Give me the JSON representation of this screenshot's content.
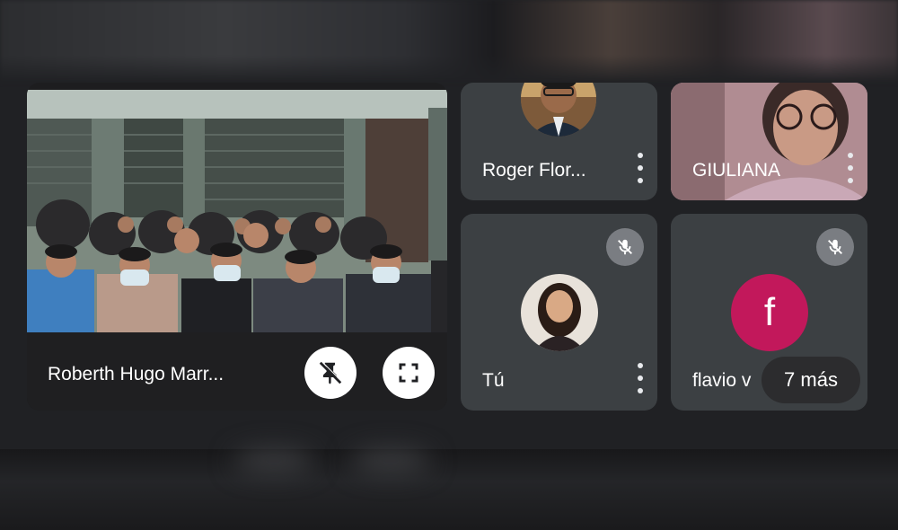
{
  "participants": {
    "main": {
      "name": "Roberth Hugo Marr..."
    },
    "roger": {
      "name": "Roger Flor..."
    },
    "giuliana": {
      "name": "GIULIANA"
    },
    "self": {
      "name": "Tú"
    },
    "flavio": {
      "name": "flavio v",
      "avatar_letter": "f",
      "avatar_color": "#c2185b"
    }
  },
  "overflow": {
    "label": "7 más"
  },
  "icons": {
    "unpin": "pin-off-icon",
    "fullscreen": "fullscreen-icon",
    "more": "more-vert-icon",
    "mic_off": "mic-off-icon"
  }
}
